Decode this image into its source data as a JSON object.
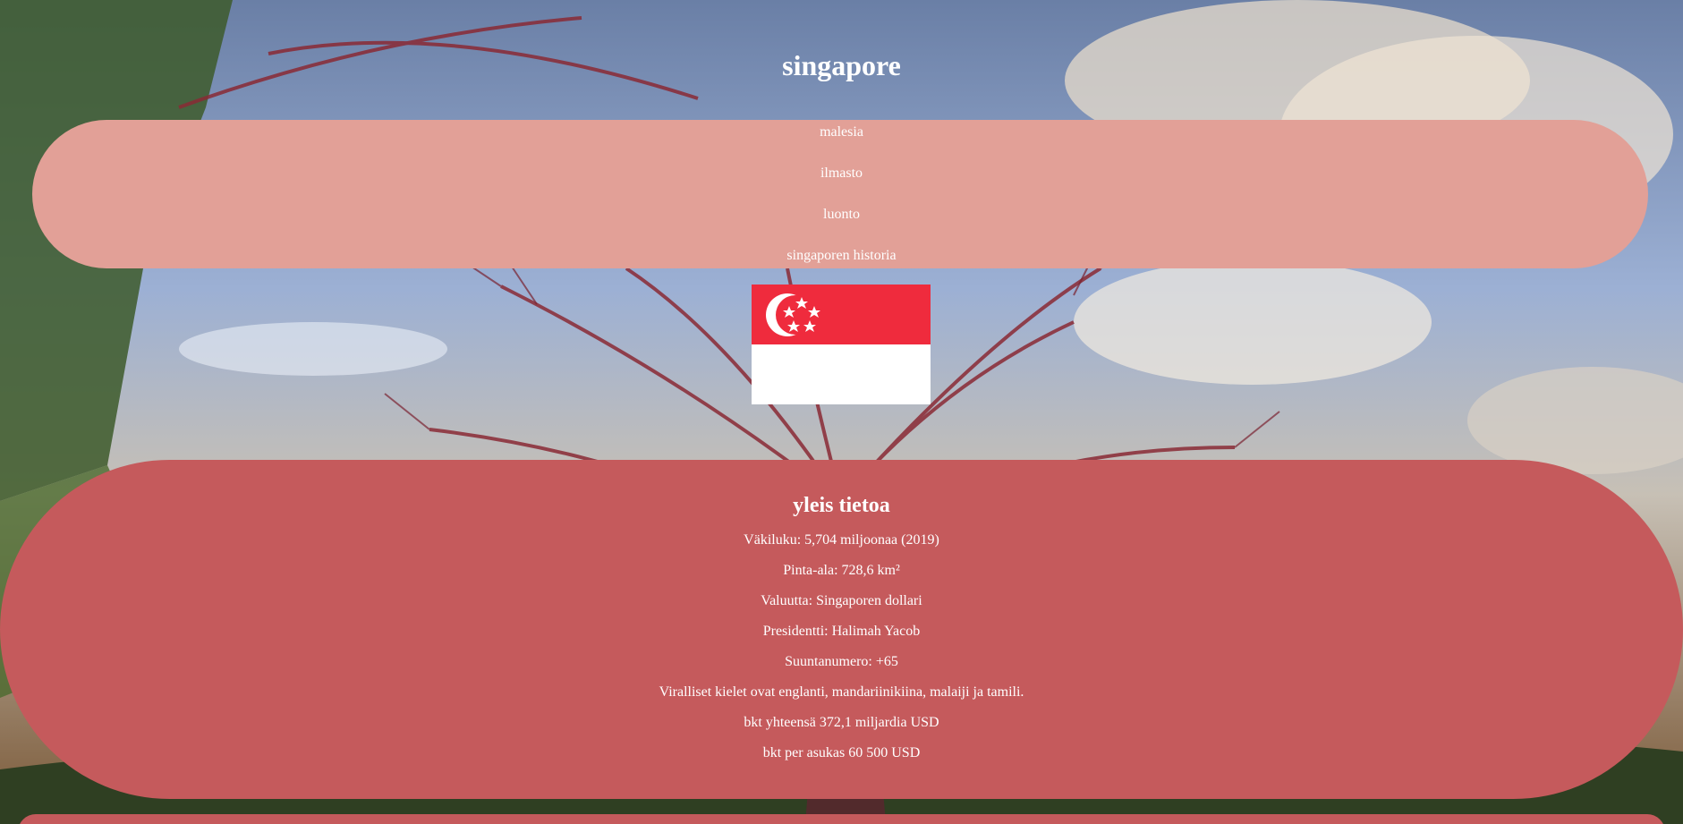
{
  "page": {
    "title": "singapore"
  },
  "nav": {
    "items": [
      {
        "label": "malesia"
      },
      {
        "label": "ilmasto"
      },
      {
        "label": "luonto"
      },
      {
        "label": "singaporen historia"
      }
    ]
  },
  "flag": {
    "description_icon": "singapore-flag",
    "colors": {
      "red": "#ef2b3d",
      "white": "#ffffff"
    }
  },
  "info": {
    "heading": "yleis tietoa",
    "lines": [
      "Väkiluku: 5,704 miljoonaa (2019)",
      "Pinta-ala: 728,6 km²",
      "Valuutta: Singaporen dollari",
      "Presidentti: Halimah Yacob",
      "Suuntanumero: +65",
      "Viralliset kielet ovat englanti, mandariinikiina, malaiji ja tamili.",
      "bkt yhteensä 372,1 miljardia USD",
      "bkt per asukas 60 500 USD"
    ]
  },
  "colors": {
    "nav_bg": "#e2a097",
    "info_bg": "#c55a5c",
    "text": "#ffffff"
  }
}
